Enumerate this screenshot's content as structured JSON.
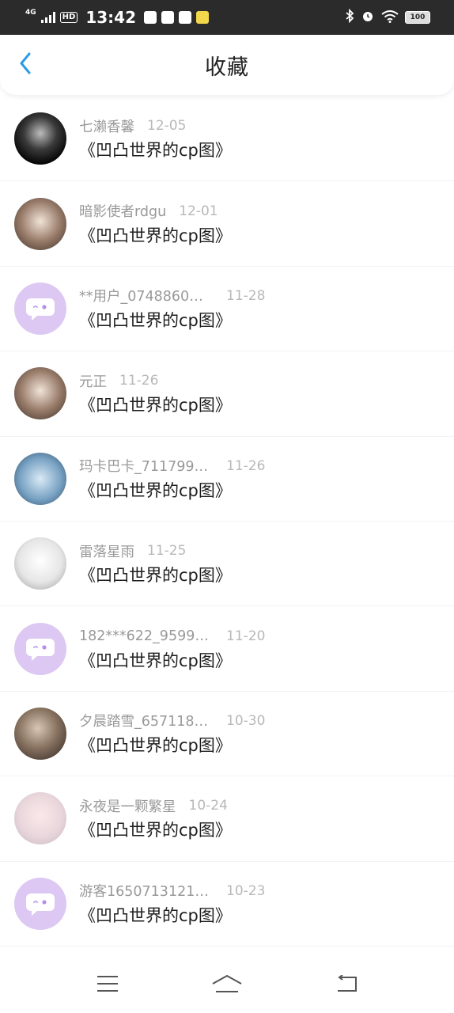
{
  "status_bar": {
    "network": "4G",
    "hd": "HD",
    "time": "13:42",
    "battery": "100"
  },
  "header": {
    "title": "收藏"
  },
  "items": [
    {
      "username": "七濑香馨",
      "date": "12-05",
      "title": "《凹凸世界的cp图》",
      "avatar": "photo-dark"
    },
    {
      "username": "暗影使者rdgu",
      "date": "12-01",
      "title": "《凹凸世界的cp图》",
      "avatar": "photo-sepia"
    },
    {
      "username": "**用户_0748860…",
      "date": "11-28",
      "title": "《凹凸世界的cp图》",
      "avatar": "placeholder"
    },
    {
      "username": "元正",
      "date": "11-26",
      "title": "《凹凸世界的cp图》",
      "avatar": "photo-sepia"
    },
    {
      "username": "玛卡巴卡_711799…",
      "date": "11-26",
      "title": "《凹凸世界的cp图》",
      "avatar": "photo-blue"
    },
    {
      "username": "雷落星雨",
      "date": "11-25",
      "title": "《凹凸世界的cp图》",
      "avatar": "photo-white"
    },
    {
      "username": "182***622_9599…",
      "date": "11-20",
      "title": "《凹凸世界的cp图》",
      "avatar": "placeholder"
    },
    {
      "username": "夕晨踏雪_657118…",
      "date": "10-30",
      "title": "《凹凸世界的cp图》",
      "avatar": "photo"
    },
    {
      "username": "永夜是一颗繁星",
      "date": "10-24",
      "title": "《凹凸世界的cp图》",
      "avatar": "photo-pale"
    },
    {
      "username": "游客1650713121…",
      "date": "10-23",
      "title": "《凹凸世界的cp图》",
      "avatar": "placeholder"
    }
  ],
  "colors": {
    "accent": "#2b9be8",
    "placeholder_avatar": "#dcc8f2"
  }
}
